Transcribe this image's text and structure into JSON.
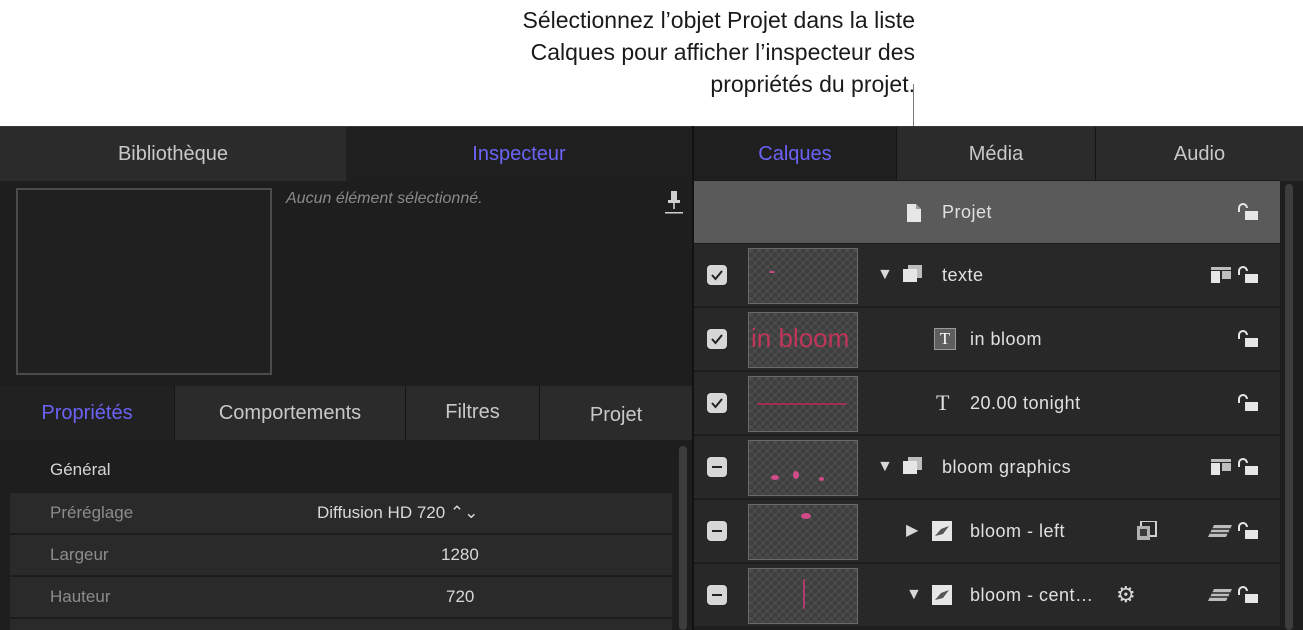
{
  "callout": {
    "line1": "Sélectionnez l’objet Projet dans la liste",
    "line2": "Calques pour afficher l’inspecteur des",
    "line3": "propriétés du projet."
  },
  "tabs": {
    "library": "Bibliothèque",
    "inspector": "Inspecteur",
    "layers": "Calques",
    "media": "Média",
    "audio": "Audio"
  },
  "inspector": {
    "no_selection": "Aucun élément sélectionné.",
    "subtabs": [
      "Propriétés",
      "Comportements",
      "Filtres",
      "Projet"
    ],
    "section_title": "Général",
    "rows": [
      {
        "label": "Préréglage",
        "value": "Diffusion HD 720 ⌃⌄"
      },
      {
        "label": "Largeur",
        "value": "1280"
      },
      {
        "label": "Hauteur",
        "value": "720"
      }
    ]
  },
  "layers": {
    "project": "Projet",
    "items": [
      {
        "name": "texte",
        "type": "group",
        "checked": true
      },
      {
        "name": "in bloom",
        "type": "text",
        "checked": true,
        "thumb_text": "in bloom"
      },
      {
        "name": "20.00 tonight",
        "type": "text",
        "checked": true
      },
      {
        "name": "bloom graphics",
        "type": "group",
        "checked": false
      },
      {
        "name": "bloom - left",
        "type": "image",
        "checked": false
      },
      {
        "name": "bloom - cent…",
        "type": "image",
        "checked": false
      }
    ]
  },
  "colors": {
    "accent": "#6b63f5",
    "panel": "#1e1e1e",
    "selected_row": "#5a5a5a"
  }
}
